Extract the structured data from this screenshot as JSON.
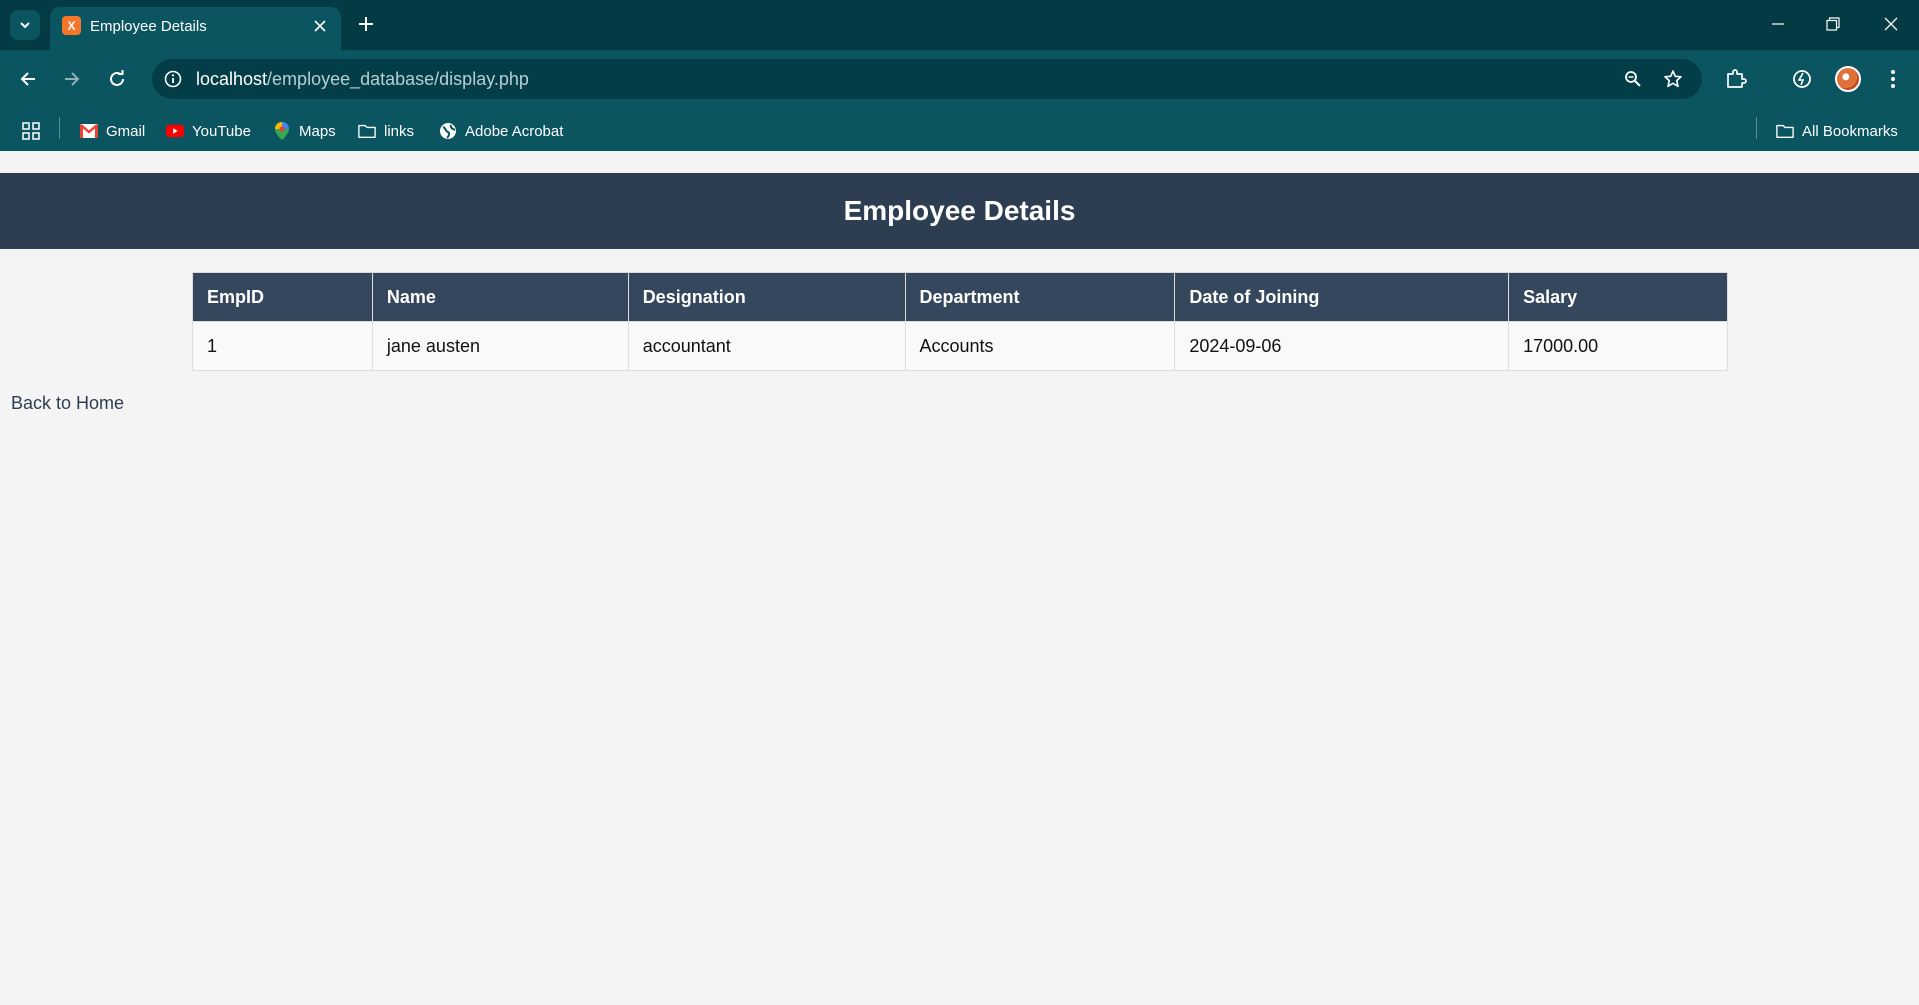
{
  "browser": {
    "tab_title": "Employee Details",
    "tab_favicon": "X",
    "url_host": "localhost",
    "url_path": "/employee_database/display.php",
    "bookmarks": [
      {
        "label": "Gmail",
        "icon": "gmail-icon"
      },
      {
        "label": "YouTube",
        "icon": "youtube-icon"
      },
      {
        "label": "Maps",
        "icon": "maps-icon"
      },
      {
        "label": "links",
        "icon": "folder-icon"
      },
      {
        "label": "Adobe Acrobat",
        "icon": "globe-icon"
      }
    ],
    "all_bookmarks": "All Bookmarks"
  },
  "page": {
    "title": "Employee Details",
    "table": {
      "headers": [
        "EmpID",
        "Name",
        "Designation",
        "Department",
        "Date of Joining",
        "Salary"
      ],
      "rows": [
        [
          "1",
          "jane austen",
          "accountant",
          "Accounts",
          "2024-09-06",
          "17000.00"
        ]
      ]
    },
    "back_link": "Back to Home"
  },
  "colors": {
    "chrome": "#0b5560",
    "tabstrip": "#033a43",
    "header": "#2e3e52",
    "table_header": "#34475d",
    "page_bg": "#f4f4f4"
  }
}
